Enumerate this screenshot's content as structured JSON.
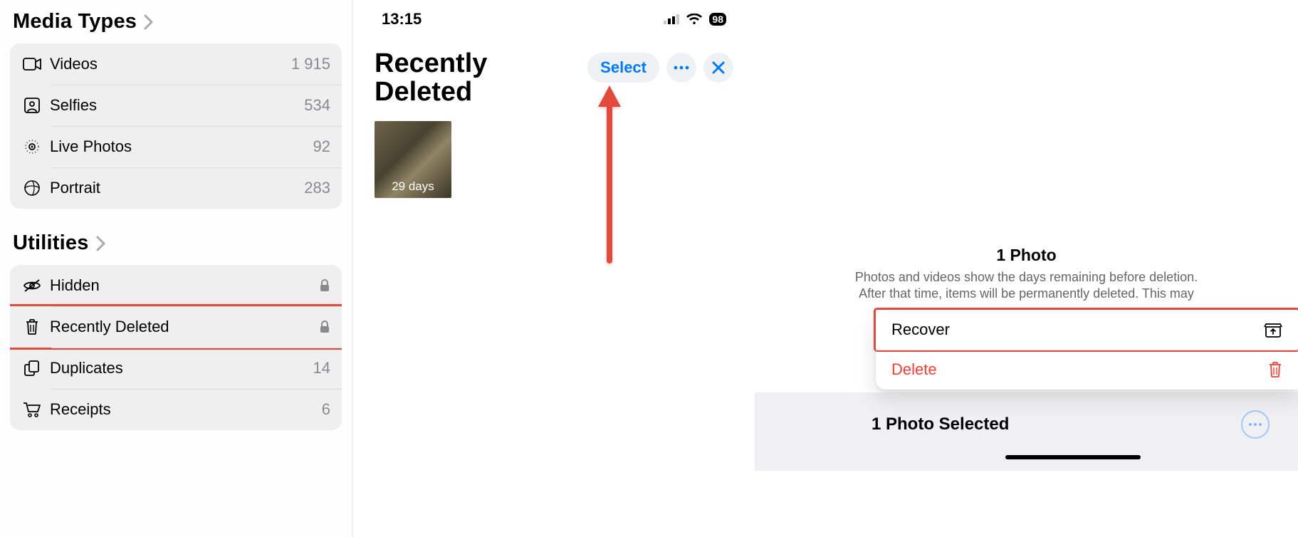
{
  "panel1": {
    "media_types_header": "Media Types",
    "utilities_header": "Utilities",
    "media_types": [
      {
        "label": "Videos",
        "count": "1 915"
      },
      {
        "label": "Selfies",
        "count": "534"
      },
      {
        "label": "Live Photos",
        "count": "92"
      },
      {
        "label": "Portrait",
        "count": "283"
      }
    ],
    "utilities": [
      {
        "label": "Hidden",
        "locked": true
      },
      {
        "label": "Recently Deleted",
        "locked": true,
        "highlighted": true
      },
      {
        "label": "Duplicates",
        "count": "14"
      },
      {
        "label": "Receipts",
        "count": "6"
      }
    ]
  },
  "panel2": {
    "status_time": "13:15",
    "battery_pct": "98",
    "title_line1": "Recently",
    "title_line2": "Deleted",
    "select_label": "Select",
    "thumb_days": "29 days"
  },
  "panel3": {
    "info_title": "1 Photo",
    "info_sub_l1": "Photos and videos show the days remaining before deletion.",
    "info_sub_l2": "After that time, items will be permanently deleted. This may",
    "recover_label": "Recover",
    "delete_label": "Delete",
    "selected_label": "1 Photo Selected"
  }
}
